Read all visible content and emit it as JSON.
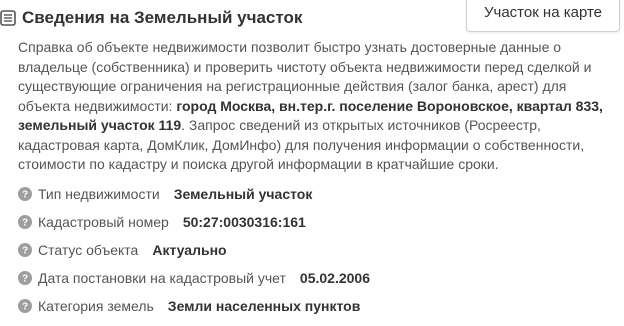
{
  "header": {
    "title": "Сведения на Земельный участок",
    "map_button": "Участок на карте"
  },
  "description": {
    "text_before": "Справка об объекте недвижимости позволит быстро узнать достоверные данные о владельце (собственника) и проверить чистоту объекта недвижимости перед сделкой и существующие ограничения на регистрационные действия (залог банка, арест) для объекта недвижимости: ",
    "address_bold": "город Москва, вн.тер.г. поселение Вороновское, квартал 833, земельный участок 119",
    "text_after": ". Запрос сведений из открытых источников (Росреестр, кадастровая карта, ДомКлик, ДомИнфо) для получения информации о собственности, стоимости по кадастру и поиска другой информации в кратчайшие сроки."
  },
  "properties": [
    {
      "label": "Тип недвижимости",
      "value": "Земельный участок"
    },
    {
      "label": "Кадастровый номер",
      "value": "50:27:0030316:161"
    },
    {
      "label": "Статус объекта",
      "value": "Актуально"
    },
    {
      "label": "Дата постановки на кадастровый учет",
      "value": "05.02.2006"
    },
    {
      "label": "Категория земель",
      "value": "Земли населенных пунктов"
    }
  ],
  "colors": {
    "icon_gray": "#9e9e9e",
    "text": "#333333",
    "muted": "#555555"
  },
  "icons": {
    "header": "checklist-icon",
    "property": "question-circle-icon"
  }
}
